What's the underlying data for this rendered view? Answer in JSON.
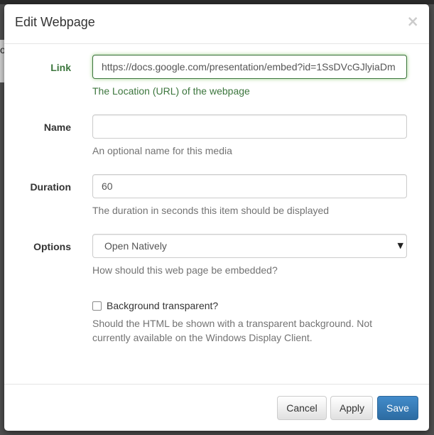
{
  "dialog": {
    "title": "Edit Webpage",
    "close_symbol": "×"
  },
  "backdrop": {
    "left_fragment": "o"
  },
  "fields": {
    "link": {
      "label": "Link",
      "value": "https://docs.google.com/presentation/embed?id=1SsDVcGJlyiaDm",
      "help": "The Location (URL) of the webpage"
    },
    "name": {
      "label": "Name",
      "value": "",
      "help": "An optional name for this media"
    },
    "duration": {
      "label": "Duration",
      "value": "60",
      "help": "The duration in seconds this item should be displayed"
    },
    "options": {
      "label": "Options",
      "selected": "Open Natively",
      "help": "How should this web page be embedded?"
    },
    "background_transparent": {
      "label": "Background transparent?",
      "checked": false,
      "help": "Should the HTML be shown with a transparent background. Not currently available on the Windows Display Client."
    }
  },
  "footer": {
    "cancel_label": "Cancel",
    "apply_label": "Apply",
    "save_label": "Save"
  },
  "colors": {
    "success": "#3c763d",
    "primary": "#337ab7"
  }
}
